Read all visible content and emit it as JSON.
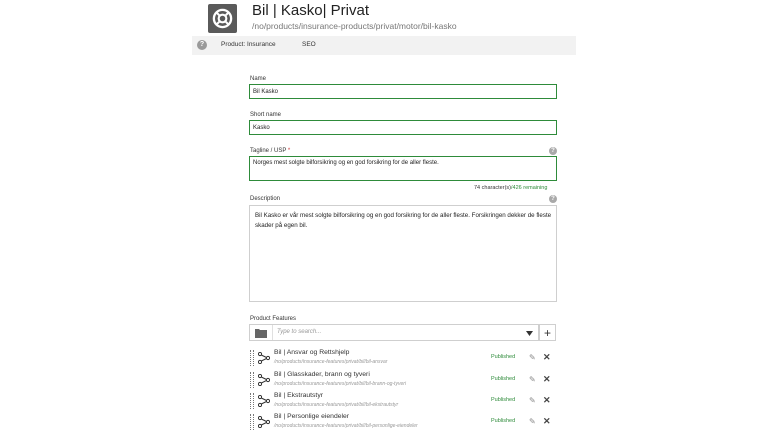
{
  "header": {
    "icon": "lifebuoy-icon",
    "title": "Bil | Kasko| Privat",
    "path": "/no/products/insurance-products/privat/motor/bil-kasko"
  },
  "tabs": [
    {
      "label": "Product: Insurance",
      "active": true
    },
    {
      "label": "SEO",
      "active": false
    }
  ],
  "form": {
    "name": {
      "label": "Name",
      "value": "Bil Kasko"
    },
    "short_name": {
      "label": "Short name",
      "value": "Kasko"
    },
    "tagline": {
      "label": "Tagline / USP",
      "required_marker": "*",
      "value": "Norges mest solgte bilforsikring og en god forsikring for de aller fleste."
    },
    "counter": {
      "count": "74 character(s)",
      "remaining": "/426 remaining"
    },
    "description": {
      "label": "Description",
      "value": "Bil Kasko er vår mest solgte bilforsikring og en god forsikring for de aller fleste. Forsikringen dekker de fleste skader på egen bil."
    }
  },
  "product_features": {
    "label": "Product Features",
    "search_placeholder": "Type to search...",
    "items": [
      {
        "title": "Bil | Ansvar og Rettshjelp",
        "path": "/no/products/insurance-features/privat/bil/bil-ansvar",
        "status": "Published"
      },
      {
        "title": "Bil | Glasskader, brann og tyveri",
        "path": "/no/products/insurance-features/privat/bil/bil-brann-og-tyveri",
        "status": "Published"
      },
      {
        "title": "Bil | Ekstrautstyr",
        "path": "/no/products/insurance-features/privat/bil/bil-ekstrautstyr",
        "status": "Published"
      },
      {
        "title": "Bil | Personlige eiendeler",
        "path": "/no/products/insurance-features/privat/bil/bil-personlige-eiendeler",
        "status": "Published"
      }
    ]
  },
  "colors": {
    "accent": "#2e8b3a",
    "icon_bg": "#5a5a5a",
    "tabbar": "#f2f2f2"
  }
}
